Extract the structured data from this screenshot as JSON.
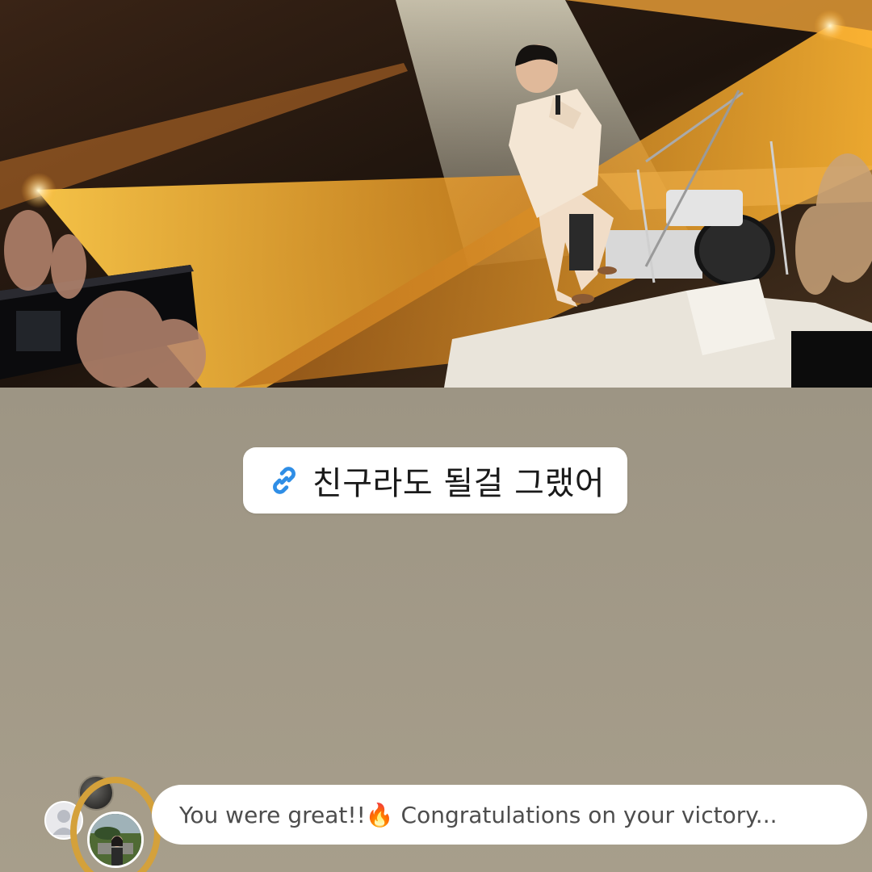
{
  "story": {
    "background_color": "#9d9584",
    "photo": {
      "description_icon": "concert-stage-photo"
    },
    "link_sticker": {
      "icon": "link-icon",
      "icon_color": "#2f8ee6",
      "text": "친구라도 될걸 그랬어"
    },
    "reply": {
      "message": "You were great!!🔥 Congratulations on your victory...",
      "highlight_color": "#d4a13b"
    }
  }
}
